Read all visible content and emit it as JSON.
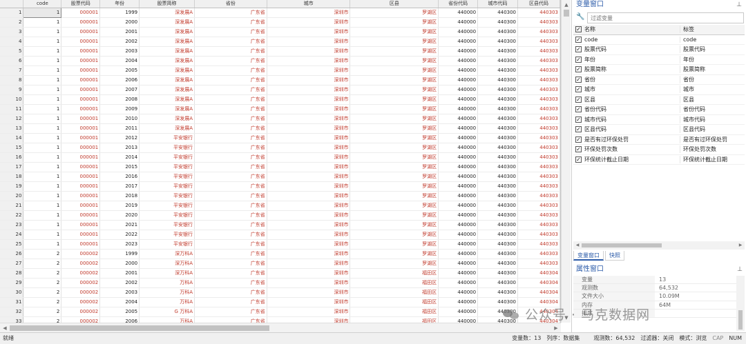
{
  "columns": [
    "code",
    "股票代码",
    "年份",
    "股票简称",
    "省份",
    "城市",
    "区县",
    "省份代码",
    "城市代码",
    "区县代码"
  ],
  "rows": [
    [
      "1",
      "1",
      "000001",
      "1999",
      "深发展A",
      "广东省",
      "深圳市",
      "罗湖区",
      "440000",
      "440300",
      "440303"
    ],
    [
      "2",
      "1",
      "000001",
      "2000",
      "深发展A",
      "广东省",
      "深圳市",
      "罗湖区",
      "440000",
      "440300",
      "440303"
    ],
    [
      "3",
      "1",
      "000001",
      "2001",
      "深发展A",
      "广东省",
      "深圳市",
      "罗湖区",
      "440000",
      "440300",
      "440303"
    ],
    [
      "4",
      "1",
      "000001",
      "2002",
      "深发展A",
      "广东省",
      "深圳市",
      "罗湖区",
      "440000",
      "440300",
      "440303"
    ],
    [
      "5",
      "1",
      "000001",
      "2003",
      "深发展A",
      "广东省",
      "深圳市",
      "罗湖区",
      "440000",
      "440300",
      "440303"
    ],
    [
      "6",
      "1",
      "000001",
      "2004",
      "深发展A",
      "广东省",
      "深圳市",
      "罗湖区",
      "440000",
      "440300",
      "440303"
    ],
    [
      "7",
      "1",
      "000001",
      "2005",
      "深发展A",
      "广东省",
      "深圳市",
      "罗湖区",
      "440000",
      "440300",
      "440303"
    ],
    [
      "8",
      "1",
      "000001",
      "2006",
      "深发展A",
      "广东省",
      "深圳市",
      "罗湖区",
      "440000",
      "440300",
      "440303"
    ],
    [
      "9",
      "1",
      "000001",
      "2007",
      "深发展A",
      "广东省",
      "深圳市",
      "罗湖区",
      "440000",
      "440300",
      "440303"
    ],
    [
      "10",
      "1",
      "000001",
      "2008",
      "深发展A",
      "广东省",
      "深圳市",
      "罗湖区",
      "440000",
      "440300",
      "440303"
    ],
    [
      "11",
      "1",
      "000001",
      "2009",
      "深发展A",
      "广东省",
      "深圳市",
      "罗湖区",
      "440000",
      "440300",
      "440303"
    ],
    [
      "12",
      "1",
      "000001",
      "2010",
      "深发展A",
      "广东省",
      "深圳市",
      "罗湖区",
      "440000",
      "440300",
      "440303"
    ],
    [
      "13",
      "1",
      "000001",
      "2011",
      "深发展A",
      "广东省",
      "深圳市",
      "罗湖区",
      "440000",
      "440300",
      "440303"
    ],
    [
      "14",
      "1",
      "000001",
      "2012",
      "平安银行",
      "广东省",
      "深圳市",
      "罗湖区",
      "440000",
      "440300",
      "440303"
    ],
    [
      "15",
      "1",
      "000001",
      "2013",
      "平安银行",
      "广东省",
      "深圳市",
      "罗湖区",
      "440000",
      "440300",
      "440303"
    ],
    [
      "16",
      "1",
      "000001",
      "2014",
      "平安银行",
      "广东省",
      "深圳市",
      "罗湖区",
      "440000",
      "440300",
      "440303"
    ],
    [
      "17",
      "1",
      "000001",
      "2015",
      "平安银行",
      "广东省",
      "深圳市",
      "罗湖区",
      "440000",
      "440300",
      "440303"
    ],
    [
      "18",
      "1",
      "000001",
      "2016",
      "平安银行",
      "广东省",
      "深圳市",
      "罗湖区",
      "440000",
      "440300",
      "440303"
    ],
    [
      "19",
      "1",
      "000001",
      "2017",
      "平安银行",
      "广东省",
      "深圳市",
      "罗湖区",
      "440000",
      "440300",
      "440303"
    ],
    [
      "20",
      "1",
      "000001",
      "2018",
      "平安银行",
      "广东省",
      "深圳市",
      "罗湖区",
      "440000",
      "440300",
      "440303"
    ],
    [
      "21",
      "1",
      "000001",
      "2019",
      "平安银行",
      "广东省",
      "深圳市",
      "罗湖区",
      "440000",
      "440300",
      "440303"
    ],
    [
      "22",
      "1",
      "000001",
      "2020",
      "平安银行",
      "广东省",
      "深圳市",
      "罗湖区",
      "440000",
      "440300",
      "440303"
    ],
    [
      "23",
      "1",
      "000001",
      "2021",
      "平安银行",
      "广东省",
      "深圳市",
      "罗湖区",
      "440000",
      "440300",
      "440303"
    ],
    [
      "24",
      "1",
      "000001",
      "2022",
      "平安银行",
      "广东省",
      "深圳市",
      "罗湖区",
      "440000",
      "440300",
      "440303"
    ],
    [
      "25",
      "1",
      "000001",
      "2023",
      "平安银行",
      "广东省",
      "深圳市",
      "罗湖区",
      "440000",
      "440300",
      "440303"
    ],
    [
      "26",
      "2",
      "000002",
      "1999",
      "深万科A",
      "广东省",
      "深圳市",
      "罗湖区",
      "440000",
      "440300",
      "440303"
    ],
    [
      "27",
      "2",
      "000002",
      "2000",
      "深万科A",
      "广东省",
      "深圳市",
      "罗湖区",
      "440000",
      "440300",
      "440303"
    ],
    [
      "28",
      "2",
      "000002",
      "2001",
      "深万科A",
      "广东省",
      "深圳市",
      "福田区",
      "440000",
      "440300",
      "440304"
    ],
    [
      "29",
      "2",
      "000002",
      "2002",
      "万科A",
      "广东省",
      "深圳市",
      "福田区",
      "440000",
      "440300",
      "440304"
    ],
    [
      "30",
      "2",
      "000002",
      "2003",
      "万科A",
      "广东省",
      "深圳市",
      "福田区",
      "440000",
      "440300",
      "440304"
    ],
    [
      "31",
      "2",
      "000002",
      "2004",
      "万科A",
      "广东省",
      "深圳市",
      "福田区",
      "440000",
      "440300",
      "440304"
    ],
    [
      "32",
      "2",
      "000002",
      "2005",
      "G 万科A",
      "广东省",
      "深圳市",
      "福田区",
      "440000",
      "440300",
      "440304"
    ],
    [
      "33",
      "2",
      "000002",
      "2006",
      "万科A",
      "广东省",
      "深圳市",
      "福田区",
      "440000",
      "440300",
      "440304"
    ]
  ],
  "var_window": {
    "title": "变量窗口",
    "pin": "⊥",
    "filter_placeholder": "过滤变量",
    "header_name": "名称",
    "header_label": "标签",
    "vars": [
      {
        "name": "code",
        "label": "code"
      },
      {
        "name": "股票代码",
        "label": "股票代码"
      },
      {
        "name": "年份",
        "label": "年份"
      },
      {
        "name": "股票简称",
        "label": "股票简称"
      },
      {
        "name": "省份",
        "label": "省份"
      },
      {
        "name": "城市",
        "label": "城市"
      },
      {
        "name": "区县",
        "label": "区县"
      },
      {
        "name": "省份代码",
        "label": "省份代码"
      },
      {
        "name": "城市代码",
        "label": "城市代码"
      },
      {
        "name": "区县代码",
        "label": "区县代码"
      },
      {
        "name": "是否有过环保处罚",
        "label": "是否有过环保处罚"
      },
      {
        "name": "环保处罚次数",
        "label": "环保处罚次数"
      },
      {
        "name": "环保统计截止日期",
        "label": "环保统计截止日期"
      }
    ]
  },
  "tabs": {
    "var_tab": "变量窗口",
    "snap_tab": "快照"
  },
  "props_window": {
    "title": "属性窗口",
    "pin": "⊥",
    "items": [
      {
        "k": "变量",
        "v": "13"
      },
      {
        "k": "观测数",
        "v": "64,532"
      },
      {
        "k": "文件大小",
        "v": "10.09M"
      },
      {
        "k": "内存",
        "v": "64M"
      },
      {
        "k": "排序",
        "v": ""
      }
    ]
  },
  "watermark": "公众号 · 马克数据网",
  "status": {
    "left": "就绪",
    "vars": "变量数：13",
    "order": "列序：数据集",
    "obs": "观测数：64,532",
    "filter": "过滤器：关闭",
    "mode": "模式：浏览",
    "cap": "CAP",
    "num": "NUM"
  }
}
